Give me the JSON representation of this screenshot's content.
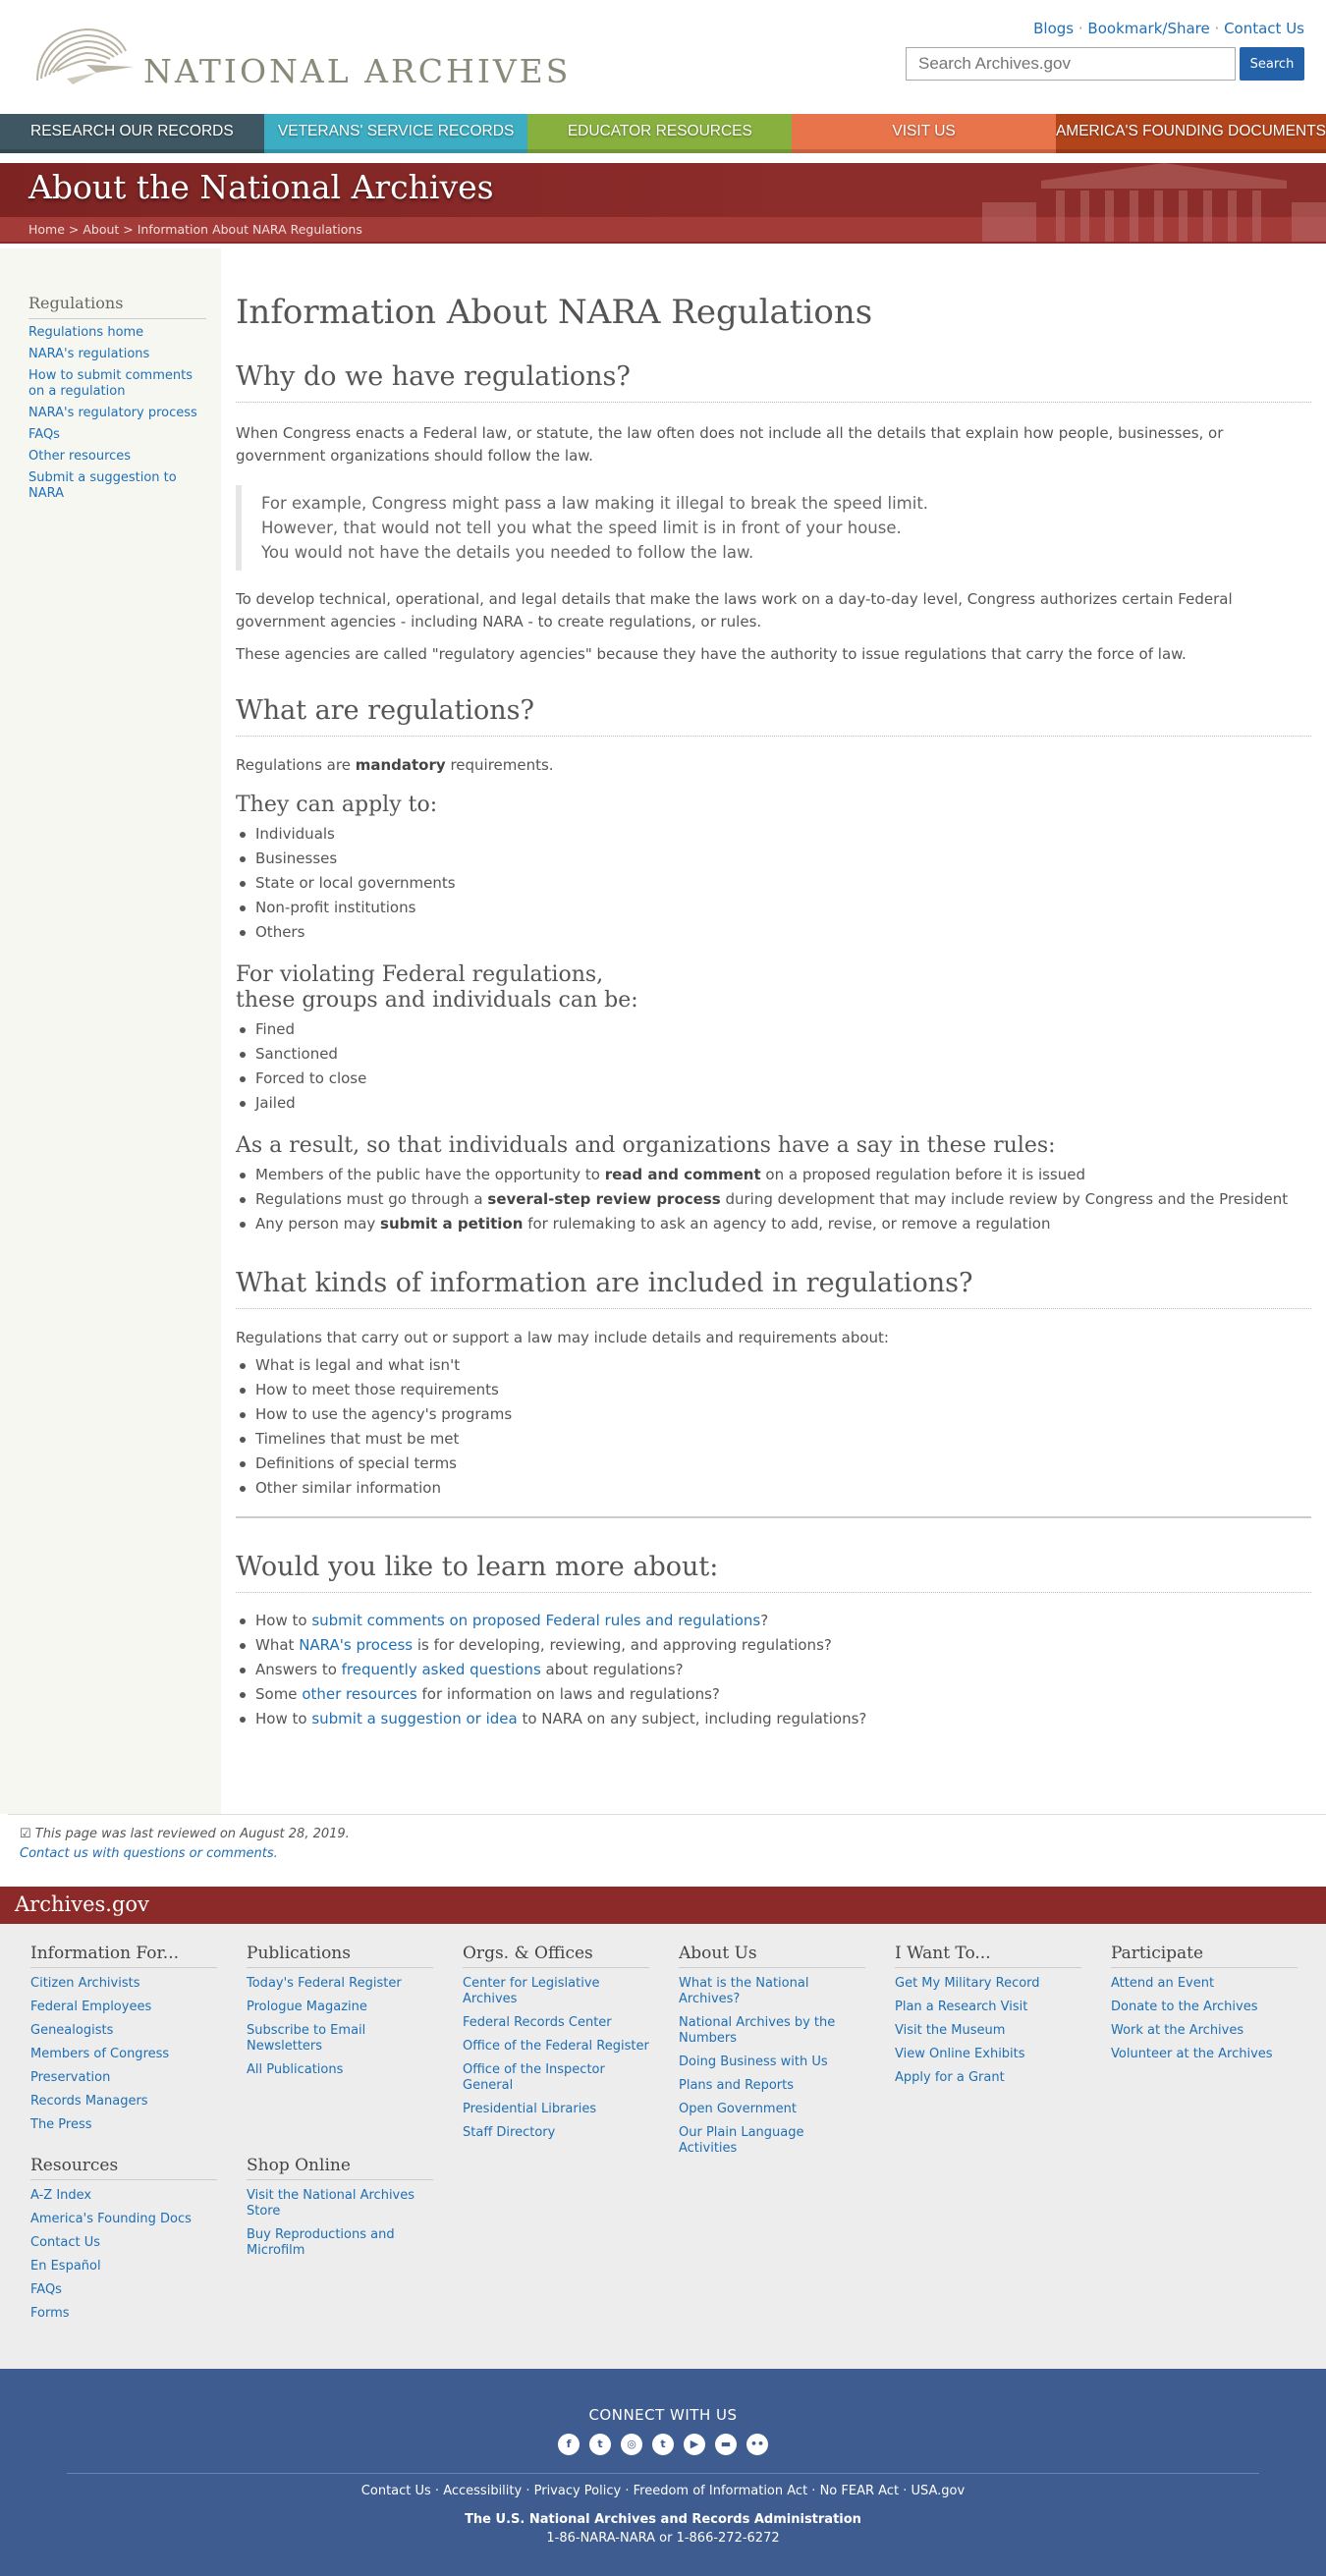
{
  "header": {
    "logo_text": "NATIONAL ARCHIVES",
    "util_links": [
      "Blogs",
      "Bookmark/Share",
      "Contact Us"
    ],
    "search_placeholder": "Search Archives.gov",
    "search_button": "Search"
  },
  "nav": [
    {
      "label": "Research Our Records",
      "color": "#3e5762"
    },
    {
      "label": "Veterans' Service Records",
      "color": "#3cadc3"
    },
    {
      "label": "Educator Resources",
      "color": "#88b03e"
    },
    {
      "label": "Visit Us",
      "color": "#e8744b"
    },
    {
      "label": "America's Founding Documents",
      "color": "#b2441c"
    }
  ],
  "banner": {
    "title": "About the National Archives",
    "breadcrumb": [
      "Home",
      "About",
      "Information About NARA Regulations"
    ]
  },
  "sidebar": {
    "title": "Regulations",
    "links": [
      "Regulations home",
      "NARA's regulations",
      "How to submit comments on a regulation",
      "NARA's regulatory process",
      "FAQs",
      "Other resources",
      "Submit a suggestion to NARA"
    ]
  },
  "main": {
    "title": "Information About NARA Regulations",
    "why": {
      "heading": "Why do we have regulations?",
      "p1": "When Congress enacts a Federal law, or statute, the law often does not include all the details that explain how people, businesses, or government organizations should follow the law.",
      "quote": [
        "For example, Congress might pass a law making it illegal to break the speed limit.",
        "However, that would not tell you what the speed limit is in front of your house.",
        "You would not have the details you needed to follow the law."
      ],
      "p2": "To develop technical, operational, and legal details that make the laws work on a day-to-day level, Congress authorizes certain Federal government agencies - including NARA - to create regulations, or rules.",
      "p3": "These agencies are called \"regulatory agencies\" because they have the authority to issue regulations that carry the force of law."
    },
    "what": {
      "heading": "What are regulations?",
      "p_pre": "Regulations are ",
      "p_bold": "mandatory",
      "p_post": " requirements.",
      "apply_heading": "They can apply to:",
      "apply_items": [
        "Individuals",
        "Businesses",
        "State or local governments",
        "Non-profit institutions",
        "Others"
      ],
      "violate_heading_1": "For violating Federal regulations,",
      "violate_heading_2": "these groups and individuals can be:",
      "violate_items": [
        "Fined",
        "Sanctioned",
        "Forced to close",
        "Jailed"
      ],
      "result_heading": "As a result, so that individuals and organizations have a say in these rules:",
      "result_items": [
        {
          "pre": "Members of the public have the opportunity to ",
          "bold": "read and comment",
          "post": " on a proposed regulation before it is issued"
        },
        {
          "pre": "Regulations must go through a ",
          "bold": "several-step review process",
          "post": " during development that may include review by Congress and the President"
        },
        {
          "pre": "Any person may ",
          "bold": "submit a petition",
          "post": " for rulemaking to ask an agency to add, revise, or remove a regulation"
        }
      ]
    },
    "kinds": {
      "heading": "What kinds of information are included in regulations?",
      "intro": "Regulations that carry out or support a law may include details and requirements about:",
      "items": [
        "What is legal and what isn't",
        "How to meet those requirements",
        "How to use the agency's programs",
        "Timelines that must be met",
        "Definitions of special terms",
        "Other similar information"
      ]
    },
    "learn": {
      "heading": "Would you like to learn more about:",
      "items": [
        {
          "pre": "How to ",
          "link": "submit comments on proposed Federal rules and regulations",
          "post": "?"
        },
        {
          "pre": "What ",
          "link": "NARA's process",
          "post": " is for developing, reviewing, and approving regulations?"
        },
        {
          "pre": "Answers to ",
          "link": "frequently asked questions",
          "post": " about regulations?"
        },
        {
          "pre": "Some ",
          "link": "other resources",
          "post": " for information on laws and regulations?"
        },
        {
          "pre": "How to ",
          "link": "submit a suggestion or idea",
          "post": " to NARA on any subject, including regulations?"
        }
      ]
    }
  },
  "review": {
    "reviewed": "This page was last reviewed on August 28, 2019.",
    "contact": "Contact us with questions or comments."
  },
  "footer": {
    "site": "Archives.gov",
    "columns": [
      {
        "title": "Information For...",
        "links": [
          "Citizen Archivists",
          "Federal Employees",
          "Genealogists",
          "Members of Congress",
          "Preservation",
          "Records Managers",
          "The Press"
        ]
      },
      {
        "title": "Publications",
        "links": [
          "Today's Federal Register",
          "Prologue Magazine",
          "Subscribe to Email Newsletters",
          "All Publications"
        ]
      },
      {
        "title": "Orgs. & Offices",
        "links": [
          "Center for Legislative Archives",
          "Federal Records Center",
          "Office of the Federal Register",
          "Office of the Inspector General",
          "Presidential Libraries",
          "Staff Directory"
        ]
      },
      {
        "title": "About Us",
        "links": [
          "What is the National Archives?",
          "National Archives by the Numbers",
          "Doing Business with Us",
          "Plans and Reports",
          "Open Government",
          "Our Plain Language Activities"
        ]
      },
      {
        "title": "I Want To...",
        "links": [
          "Get My Military Record",
          "Plan a Research Visit",
          "Visit the Museum",
          "View Online Exhibits",
          "Apply for a Grant"
        ]
      },
      {
        "title": "Participate",
        "links": [
          "Attend an Event",
          "Donate to the Archives",
          "Work at the Archives",
          "Volunteer at the Archives"
        ]
      },
      {
        "title": "Resources",
        "links": [
          "A-Z Index",
          "America's Founding Docs",
          "Contact Us",
          "En Español",
          "FAQs",
          "Forms"
        ]
      },
      {
        "title": "Shop Online",
        "links": [
          "Visit the National Archives Store",
          "Buy Reproductions and Microfilm"
        ]
      }
    ],
    "connect_title": "CONNECT WITH US",
    "social_icons": [
      "facebook-icon",
      "twitter-icon",
      "instagram-icon",
      "tumblr-icon",
      "youtube-icon",
      "blog-icon",
      "flickr-icon"
    ],
    "legal_links": [
      "Contact Us",
      "Accessibility",
      "Privacy Policy",
      "Freedom of Information Act",
      "No FEAR Act",
      "USA.gov"
    ],
    "agency": "The U.S. National Archives and Records Administration",
    "phones": "1-86-NARA-NARA or 1-866-272-6272"
  }
}
